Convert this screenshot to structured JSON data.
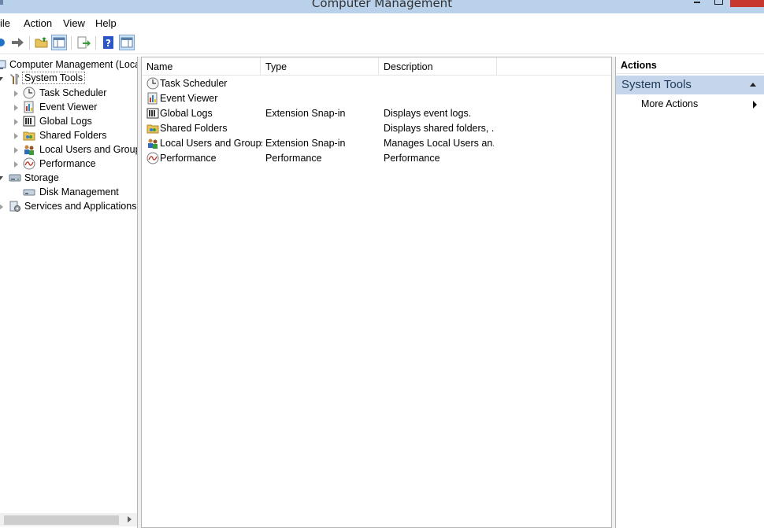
{
  "window": {
    "title": "Computer Management"
  },
  "menu": [
    "File",
    "Action",
    "View",
    "Help"
  ],
  "menu_display": [
    "ile",
    "Action",
    "View",
    "Help"
  ],
  "toolbar": {
    "buttons": [
      "back-icon",
      "forward-icon",
      "up-folder-icon",
      "show-hide-console-tree-icon",
      "export-list-icon",
      "help-icon",
      "show-hide-action-pane-icon"
    ]
  },
  "tree": {
    "root": "Computer Management (Local",
    "system_tools": "System Tools",
    "task_scheduler": "Task Scheduler",
    "event_viewer": "Event Viewer",
    "global_logs": "Global Logs",
    "shared_folders": "Shared Folders",
    "local_users": "Local Users and Groups",
    "performance": "Performance",
    "storage": "Storage",
    "disk_management": "Disk Management",
    "services": "Services and Applications"
  },
  "list": {
    "columns": {
      "name": "Name",
      "type": "Type",
      "description": "Description"
    },
    "rows": [
      {
        "name": "Task Scheduler",
        "type": "",
        "description": ""
      },
      {
        "name": "Event Viewer",
        "type": "",
        "description": ""
      },
      {
        "name": "Global Logs",
        "type": "Extension Snap-in",
        "description": "Displays event logs."
      },
      {
        "name": "Shared Folders",
        "type": "",
        "description": "Displays shared folders, ..."
      },
      {
        "name": "Local Users and Groups",
        "type": "Extension Snap-in",
        "description": "Manages Local Users an..."
      },
      {
        "name": "Performance",
        "type": "Performance",
        "description": "Performance"
      }
    ]
  },
  "actions": {
    "title": "Actions",
    "section": "System Tools",
    "more": "More Actions"
  },
  "colors": {
    "titlebar": "#b9d1ea",
    "selection": "#cce4f7",
    "actions_section": "#c6d6ea",
    "close": "#c7372f"
  }
}
